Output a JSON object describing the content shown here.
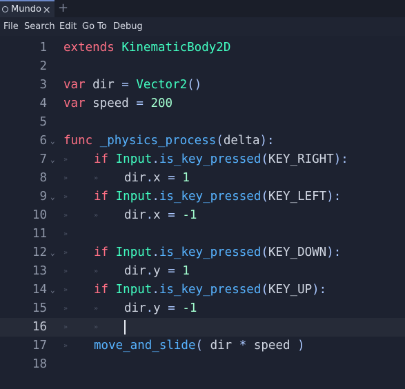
{
  "tab": {
    "title": "Mundo",
    "close": "×",
    "add": "+"
  },
  "menu": [
    "File",
    "Search",
    "Edit",
    "Go To",
    "Debug"
  ],
  "colors": {
    "keyword": "#ff7085",
    "class": "#42ffc2",
    "function": "#57b3ff",
    "number": "#a3ffd0",
    "symbol": "#abc8ff",
    "text": "#d0d6e2",
    "background": "#1d2230"
  },
  "icons": {
    "tab": "scene-icon",
    "fold_open": "fold-arrow-icon",
    "tab_marker": "tab-marker-icon"
  },
  "current_line": 16,
  "lines": [
    {
      "n": "1",
      "fold": false,
      "tabs": 0,
      "tokens": [
        [
          "extends",
          "kw"
        ],
        [
          " ",
          "txt"
        ],
        [
          "KinematicBody2D",
          "cls"
        ]
      ]
    },
    {
      "n": "2",
      "fold": false,
      "tabs": 0,
      "tokens": []
    },
    {
      "n": "3",
      "fold": false,
      "tabs": 0,
      "tokens": [
        [
          "var",
          "kw"
        ],
        [
          " dir ",
          "txt"
        ],
        [
          "=",
          "sym"
        ],
        [
          " ",
          "txt"
        ],
        [
          "Vector2",
          "cls"
        ],
        [
          "()",
          "sym"
        ]
      ]
    },
    {
      "n": "4",
      "fold": false,
      "tabs": 0,
      "tokens": [
        [
          "var",
          "kw"
        ],
        [
          " speed ",
          "txt"
        ],
        [
          "=",
          "sym"
        ],
        [
          " ",
          "txt"
        ],
        [
          "200",
          "num"
        ]
      ]
    },
    {
      "n": "5",
      "fold": false,
      "tabs": 0,
      "tokens": []
    },
    {
      "n": "6",
      "fold": true,
      "tabs": 0,
      "tokens": [
        [
          "func",
          "kw"
        ],
        [
          " ",
          "txt"
        ],
        [
          "_physics_process",
          "fn"
        ],
        [
          "(",
          "sym"
        ],
        [
          "delta",
          "txt"
        ],
        [
          "):",
          "sym"
        ]
      ]
    },
    {
      "n": "7",
      "fold": true,
      "tabs": 1,
      "tokens": [
        [
          "if",
          "kw"
        ],
        [
          " ",
          "txt"
        ],
        [
          "Input",
          "cls"
        ],
        [
          ".",
          "sym"
        ],
        [
          "is_key_pressed",
          "fn"
        ],
        [
          "(",
          "sym"
        ],
        [
          "KEY_RIGHT",
          "txt"
        ],
        [
          "):",
          "sym"
        ]
      ]
    },
    {
      "n": "8",
      "fold": false,
      "tabs": 2,
      "tokens": [
        [
          "dir",
          "txt"
        ],
        [
          ".",
          "sym"
        ],
        [
          "x ",
          "txt"
        ],
        [
          "=",
          "sym"
        ],
        [
          " ",
          "txt"
        ],
        [
          "1",
          "num"
        ]
      ]
    },
    {
      "n": "9",
      "fold": true,
      "tabs": 1,
      "tokens": [
        [
          "if",
          "kw"
        ],
        [
          " ",
          "txt"
        ],
        [
          "Input",
          "cls"
        ],
        [
          ".",
          "sym"
        ],
        [
          "is_key_pressed",
          "fn"
        ],
        [
          "(",
          "sym"
        ],
        [
          "KEY_LEFT",
          "txt"
        ],
        [
          "):",
          "sym"
        ]
      ]
    },
    {
      "n": "10",
      "fold": false,
      "tabs": 2,
      "tokens": [
        [
          "dir",
          "txt"
        ],
        [
          ".",
          "sym"
        ],
        [
          "x ",
          "txt"
        ],
        [
          "=",
          "sym"
        ],
        [
          " ",
          "txt"
        ],
        [
          "-1",
          "num"
        ]
      ]
    },
    {
      "n": "11",
      "fold": false,
      "tabs": 1,
      "tokens": []
    },
    {
      "n": "12",
      "fold": true,
      "tabs": 1,
      "tokens": [
        [
          "if",
          "kw"
        ],
        [
          " ",
          "txt"
        ],
        [
          "Input",
          "cls"
        ],
        [
          ".",
          "sym"
        ],
        [
          "is_key_pressed",
          "fn"
        ],
        [
          "(",
          "sym"
        ],
        [
          "KEY_DOWN",
          "txt"
        ],
        [
          "):",
          "sym"
        ]
      ]
    },
    {
      "n": "13",
      "fold": false,
      "tabs": 2,
      "tokens": [
        [
          "dir",
          "txt"
        ],
        [
          ".",
          "sym"
        ],
        [
          "y ",
          "txt"
        ],
        [
          "=",
          "sym"
        ],
        [
          " ",
          "txt"
        ],
        [
          "1",
          "num"
        ]
      ]
    },
    {
      "n": "14",
      "fold": true,
      "tabs": 1,
      "tokens": [
        [
          "if",
          "kw"
        ],
        [
          " ",
          "txt"
        ],
        [
          "Input",
          "cls"
        ],
        [
          ".",
          "sym"
        ],
        [
          "is_key_pressed",
          "fn"
        ],
        [
          "(",
          "sym"
        ],
        [
          "KEY_UP",
          "txt"
        ],
        [
          "):",
          "sym"
        ]
      ]
    },
    {
      "n": "15",
      "fold": false,
      "tabs": 2,
      "tokens": [
        [
          "dir",
          "txt"
        ],
        [
          ".",
          "sym"
        ],
        [
          "y ",
          "txt"
        ],
        [
          "=",
          "sym"
        ],
        [
          " ",
          "txt"
        ],
        [
          "-1",
          "num"
        ]
      ]
    },
    {
      "n": "16",
      "fold": false,
      "tabs": 2,
      "tokens": []
    },
    {
      "n": "17",
      "fold": false,
      "tabs": 1,
      "tokens": [
        [
          "move_and_slide",
          "fn"
        ],
        [
          "( ",
          "sym"
        ],
        [
          "dir ",
          "txt"
        ],
        [
          "*",
          "sym"
        ],
        [
          " speed ",
          "txt"
        ],
        [
          ")",
          "sym"
        ]
      ]
    },
    {
      "n": "18",
      "fold": false,
      "tabs": 0,
      "tokens": []
    }
  ]
}
